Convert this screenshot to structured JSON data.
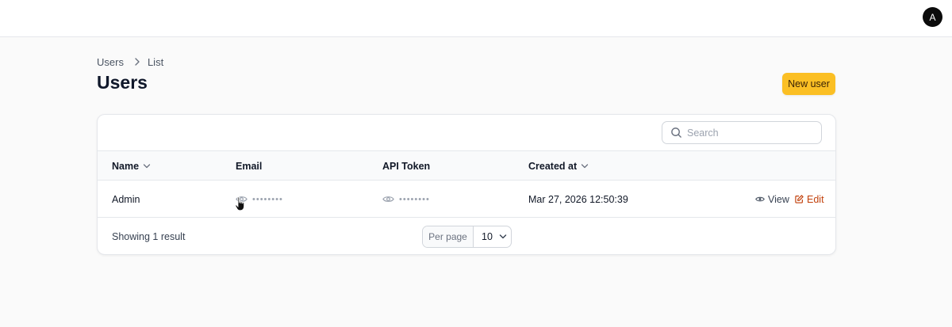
{
  "topbar": {
    "avatar_initial": "A"
  },
  "breadcrumb": {
    "items": [
      "Users",
      "List"
    ]
  },
  "page": {
    "title": "Users",
    "new_button_label": "New user"
  },
  "table": {
    "search_placeholder": "Search",
    "columns": [
      {
        "label": "Name",
        "sortable": true
      },
      {
        "label": "Email",
        "sortable": false
      },
      {
        "label": "API Token",
        "sortable": false
      },
      {
        "label": "Created at",
        "sortable": true
      }
    ],
    "rows": [
      {
        "name": "Admin",
        "email_masked": "••••••••",
        "api_token_masked": "••••••••",
        "created_at": "Mar 27, 2026 12:50:39",
        "actions": {
          "view": "View",
          "edit": "Edit"
        }
      }
    ],
    "footer": {
      "showing_text": "Showing 1 result",
      "per_page_label": "Per page",
      "per_page_value": "10"
    }
  },
  "colors": {
    "accent": "#fbbf24",
    "edit_action": "#c2410c",
    "background": "#fafafa"
  }
}
